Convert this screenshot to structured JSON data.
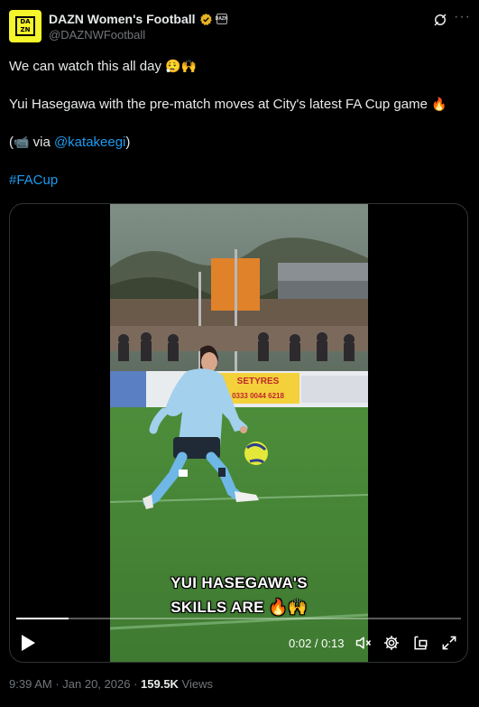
{
  "author": {
    "display_name": "DAZN Women's Football",
    "handle": "@DAZNWFootball",
    "avatar_letters": [
      "DA",
      "ZN"
    ],
    "verified_color": "#e8b422",
    "affiliate_badge": "DAZN"
  },
  "tweet": {
    "line1_text": "We can watch this all day ",
    "line1_emoji": "😮‍💨🙌",
    "line2_text": "Yui Hasegawa with the pre-match moves at City's latest FA Cup game ",
    "line2_emoji": "🔥",
    "line3_prefix": "(",
    "line3_emoji": "📹",
    "line3_via": " via ",
    "line3_mention": "@katakeegi",
    "line3_suffix": ")",
    "hashtag": "#FACup"
  },
  "video": {
    "caption_line1": "YUI HASEGAWA'S",
    "caption_line2": "SKILLS ARE 🔥🙌",
    "banner_text": "SETYRES",
    "banner_phone": "0333 0044 6218",
    "progress_fraction": 0.118,
    "time_display": "0:02 / 0:13"
  },
  "icons": {
    "grok": "grok-icon",
    "more": "more-icon",
    "play": "play-icon",
    "mute": "volume-muted-icon",
    "settings": "gear-icon",
    "popout": "pop-out-icon",
    "fullscreen": "fullscreen-icon"
  },
  "footer": {
    "time": "9:39 AM",
    "sep1": " · ",
    "date": "Jan 20, 2026",
    "sep2": " · ",
    "views_count": "159.5K",
    "views_label": " Views"
  },
  "colors": {
    "accent_link": "#1d9bf0",
    "background": "#000000",
    "muted_text": "#71767b",
    "pitch_green": "#4a8a3a"
  }
}
